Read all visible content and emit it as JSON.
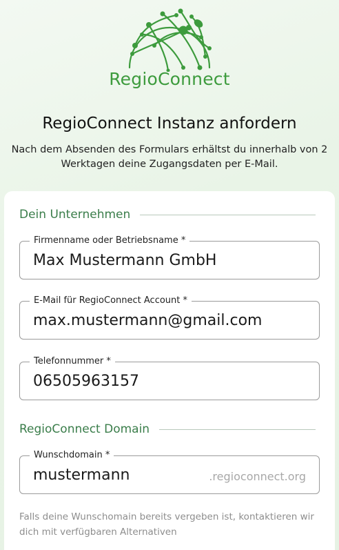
{
  "brand": {
    "name": "RegioConnect",
    "color": "#3d9b3d"
  },
  "header": {
    "title": "RegioConnect Instanz anfordern",
    "subtitle": "Nach dem Absenden des Formulars erhältst du innerhalb von 2 Werktagen deine Zugangsdaten per E-Mail."
  },
  "form": {
    "company_section": {
      "heading": "Dein Unternehmen",
      "fields": {
        "company_name": {
          "label": "Firmenname oder Betriebsname *",
          "value": "Max Mustermann GmbH"
        },
        "email": {
          "label": "E-Mail für RegioConnect Account *",
          "value": "max.mustermann@gmail.com"
        },
        "phone": {
          "label": "Telefonnummer *",
          "value": "06505963157"
        }
      }
    },
    "domain_section": {
      "heading": "RegioConnect Domain",
      "fields": {
        "domain": {
          "label": "Wunschdomain *",
          "value": "mustermann",
          "suffix": ".regioconnect.org"
        }
      },
      "hint": "Falls deine Wunschomain bereits vergeben ist, kontaktieren wir dich mit verfügbaren Alternativen"
    }
  },
  "colors": {
    "section_heading": "#3a7d4a",
    "background": "#eaf4e8",
    "field_border": "#9a9a9a"
  }
}
